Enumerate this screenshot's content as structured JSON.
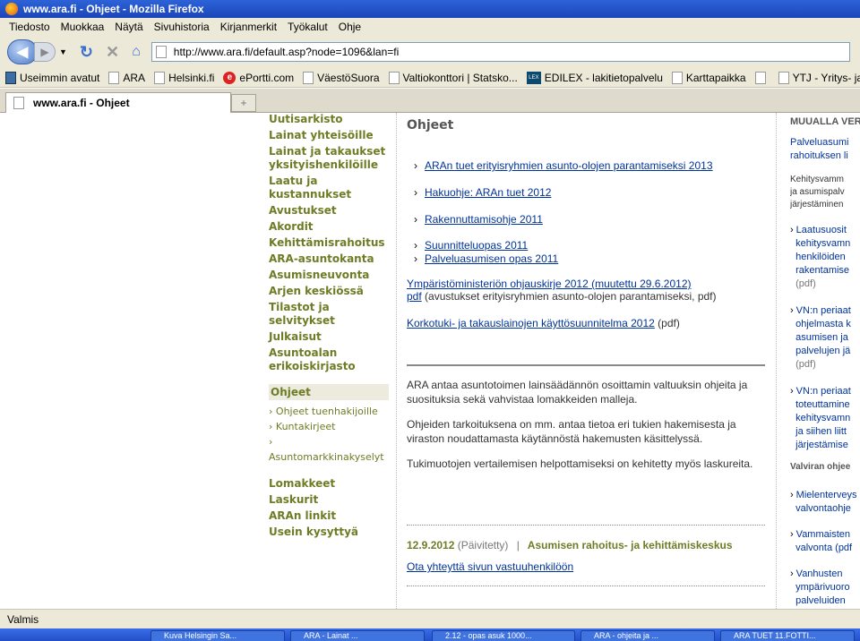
{
  "window": {
    "title": "www.ara.fi - Ohjeet - Mozilla Firefox"
  },
  "menubar": {
    "items": [
      "Tiedosto",
      "Muokkaa",
      "Näytä",
      "Sivuhistoria",
      "Kirjanmerkit",
      "Työkalut",
      "Ohje"
    ]
  },
  "navbar": {
    "url": "http://www.ara.fi/default.asp?node=1096&lan=fi"
  },
  "bookmarks": [
    {
      "label": "Useimmin avatut",
      "icon": "search-icon"
    },
    {
      "label": "ARA",
      "icon": "page-icon"
    },
    {
      "label": "Helsinki.fi",
      "icon": "page-icon"
    },
    {
      "label": "ePortti.com",
      "icon": "e-icon"
    },
    {
      "label": "VäestöSuora",
      "icon": "page-icon"
    },
    {
      "label": "Valtiokonttori | Statsko...",
      "icon": "page-icon"
    },
    {
      "label": "EDILEX - lakitietopalvelu",
      "icon": "lex-icon"
    },
    {
      "label": "Karttapaikka",
      "icon": "page-icon"
    },
    {
      "label": "",
      "icon": "page-icon"
    },
    {
      "label": "YTJ - Yritys- ja y",
      "icon": "page-icon"
    }
  ],
  "tab": {
    "label": "www.ara.fi - Ohjeet"
  },
  "leftnav": {
    "items_top": [
      "Uutisarkisto",
      "Lainat yhteisöille",
      "Lainat ja takaukset yksityishenkilöille",
      "Laatu ja kustannukset",
      "Avustukset",
      "Akordit",
      "Kehittämisrahoitus",
      "ARA-asuntokanta",
      "Asumisneuvonta",
      "Arjen keskiössä",
      "Tilastot ja selvitykset",
      "Julkaisut",
      "Asuntoalan erikoiskirjasto"
    ],
    "section": "Ohjeet",
    "sub_items": [
      "Ohjeet tuenhakijoille",
      "Kuntakirjeet",
      "Asuntomarkkinakyselyt"
    ],
    "items_bottom": [
      "Lomakkeet",
      "Laskurit",
      "ARAn linkit",
      "Usein kysyttyä"
    ]
  },
  "main": {
    "title": "Ohjeet",
    "links": [
      "ARAn tuet erityisryhmien asunto-olojen parantamiseksi 2013",
      "Hakuohje: ARAn tuet 2012",
      "Rakennuttamisohje 2011",
      "Suunnitteluopas 2011",
      "Palveluasumisen opas 2011"
    ],
    "ministry_link": "Ympäristöministeriön ohjauskirje 2012 (muutettu 29.6.2012)",
    "pdf_link": "pdf",
    "pdf_note": " (avustukset erityisryhmien asunto-olojen parantamiseksi, pdf)",
    "korko_link": "Korkotuki- ja takauslainojen käyttösuunnitelma 2012",
    "korko_note": " (pdf)",
    "para1": "ARA antaa asuntotoimen lainsäädännön osoittamin valtuuksin ohjeita ja suosituksia sekä vahvistaa lomakkeiden malleja.",
    "para2": "Ohjeiden tarkoituksena on mm. antaa tietoa eri tukien hakemisesta ja viraston noudattamasta käytännöstä hakemusten käsittelyssä.",
    "para3": "Tukimuotojen vertailemisen helpottamiseksi on kehitetty myös laskureita.",
    "footer_date": "12.9.2012",
    "footer_updated": "(Päivitetty)",
    "footer_sep": "|",
    "footer_org": "Asumisen rahoitus- ja kehittämiskeskus",
    "contact_link": "Ota yhteyttä sivun vastuuhenkilöön"
  },
  "right": {
    "header": "MUUALLA VER",
    "link1_l1": "Palveluasumi",
    "link1_l2": "rahoituksen li",
    "text1_l1": "Kehitysvamm",
    "text1_l2": "ja asumispalv",
    "text1_l3": "järjestäminen",
    "b1": [
      "Laatusuosit",
      "kehitysvamn",
      "henkilöiden",
      "rakentamise",
      "(pdf)"
    ],
    "b2": [
      "VN:n periaat",
      "ohjelmasta k",
      "asumisen ja",
      "palvelujen jä",
      "(pdf)"
    ],
    "b3": [
      "VN:n periaat",
      "toteuttamine",
      "kehitysvamn",
      "ja siihen liitt",
      "järjestämise"
    ],
    "bold2": "Valviran ohjee",
    "b4": [
      "Mielenterveys",
      "valvontaohje"
    ],
    "b5": [
      "Vammaisten",
      "valvonta (pdf"
    ],
    "b6": [
      "Vanhusten",
      "ympärivuoro",
      "palveluiden"
    ]
  },
  "statusbar": {
    "text": "Valmis"
  },
  "taskbar": {
    "items": [
      "Kuva Helsingin Sa...",
      "ARA - Lainat ...",
      "2.12 - opas asuk 1000...",
      "ARA - ohjeita ja ...",
      "ARA TUET 11.FOTTI..."
    ]
  }
}
